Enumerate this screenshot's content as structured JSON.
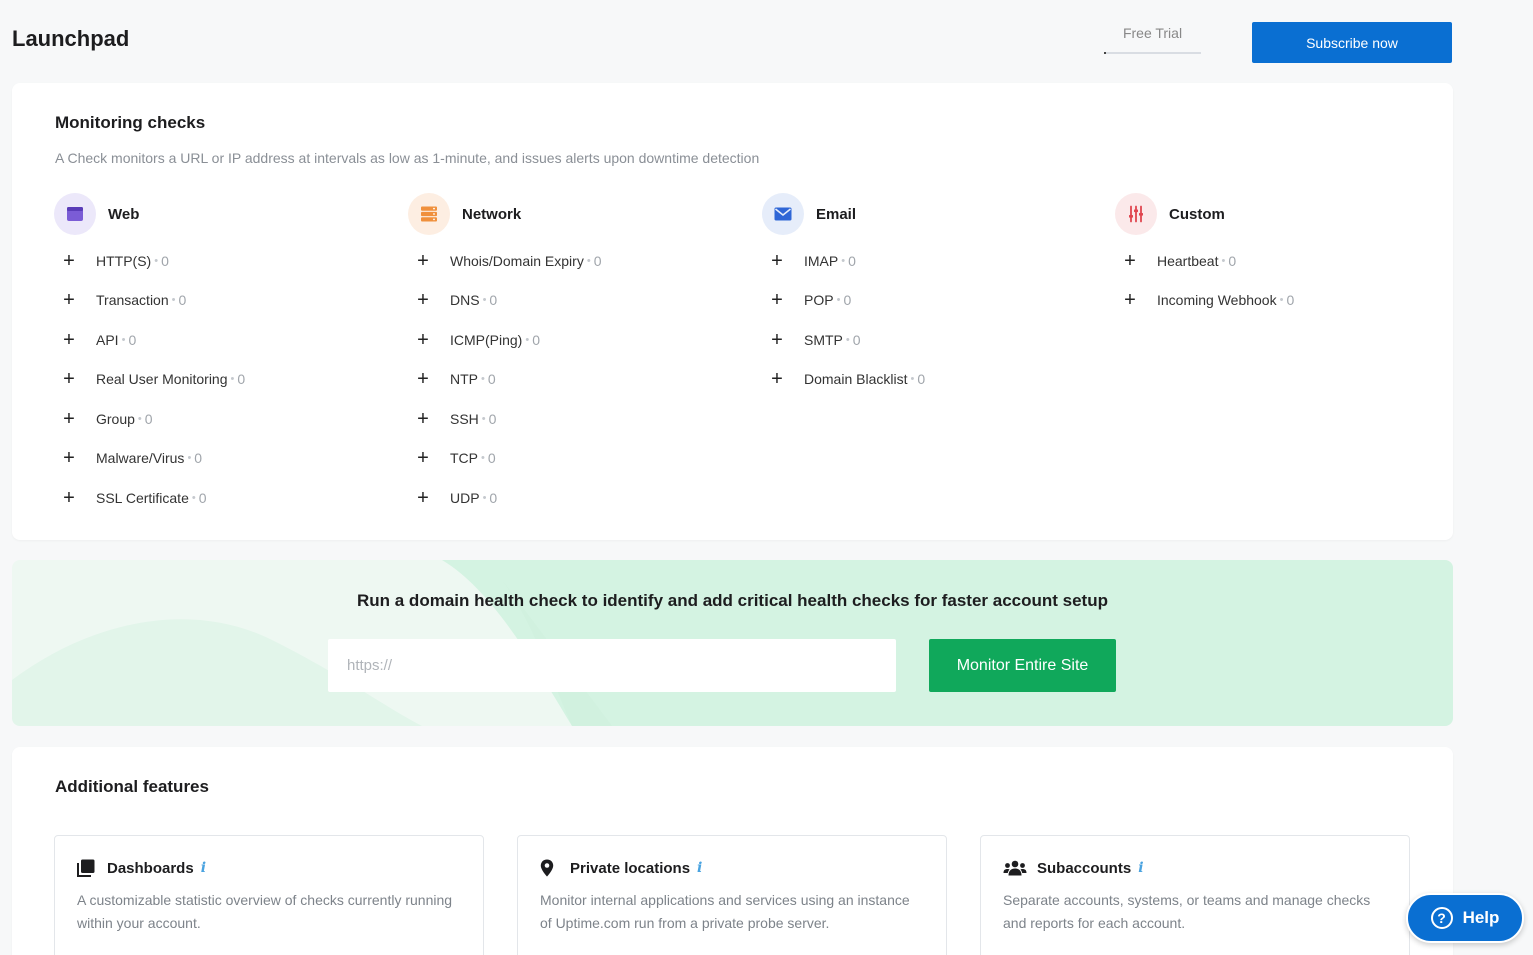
{
  "header": {
    "title": "Launchpad",
    "free_trial_label": "Free Trial",
    "subscribe_label": "Subscribe now"
  },
  "monitoring": {
    "title": "Monitoring checks",
    "description": "A Check monitors a URL or IP address at intervals as low as 1-minute, and issues alerts upon downtime detection",
    "columns": [
      {
        "name": "Web",
        "icon": "browser-window-icon",
        "color": "#7b5cd6",
        "items": [
          {
            "label": "HTTP(S)",
            "count": "0"
          },
          {
            "label": "Transaction",
            "count": "0"
          },
          {
            "label": "API",
            "count": "0"
          },
          {
            "label": "Real User Monitoring",
            "count": "0"
          },
          {
            "label": "Group",
            "count": "0"
          },
          {
            "label": "Malware/Virus",
            "count": "0"
          },
          {
            "label": "SSL Certificate",
            "count": "0"
          }
        ]
      },
      {
        "name": "Network",
        "icon": "server-icon",
        "color": "#f0903c",
        "items": [
          {
            "label": "Whois/Domain Expiry",
            "count": "0"
          },
          {
            "label": "DNS",
            "count": "0"
          },
          {
            "label": "ICMP(Ping)",
            "count": "0"
          },
          {
            "label": "NTP",
            "count": "0"
          },
          {
            "label": "SSH",
            "count": "0"
          },
          {
            "label": "TCP",
            "count": "0"
          },
          {
            "label": "UDP",
            "count": "0"
          }
        ]
      },
      {
        "name": "Email",
        "icon": "envelope-icon",
        "color": "#2f66d6",
        "items": [
          {
            "label": "IMAP",
            "count": "0"
          },
          {
            "label": "POP",
            "count": "0"
          },
          {
            "label": "SMTP",
            "count": "0"
          },
          {
            "label": "Domain Blacklist",
            "count": "0"
          }
        ]
      },
      {
        "name": "Custom",
        "icon": "sliders-icon",
        "color": "#e0454f",
        "items": [
          {
            "label": "Heartbeat",
            "count": "0"
          },
          {
            "label": "Incoming Webhook",
            "count": "0"
          }
        ]
      }
    ]
  },
  "health_check": {
    "title": "Run a domain health check to identify and add critical health checks for faster account setup",
    "input_placeholder": "https://",
    "button_label": "Monitor Entire Site"
  },
  "features": {
    "title": "Additional features",
    "cards": [
      {
        "name": "Dashboards",
        "icon": "dashboards-icon",
        "info": "i",
        "description": "A customizable statistic overview of checks currently running within your account."
      },
      {
        "name": "Private locations",
        "icon": "map-pin-icon",
        "info": "i",
        "description": "Monitor internal applications and services using an instance of Uptime.com run from a private probe server."
      },
      {
        "name": "Subaccounts",
        "icon": "users-icon",
        "info": "i",
        "description": "Separate accounts, systems, or teams and manage checks and reports for each account."
      }
    ]
  },
  "help": {
    "label": "Help"
  },
  "colors": {
    "brand_blue": "#0a6fd2",
    "brand_green": "#10a85b",
    "info_blue": "#4aa3e0"
  }
}
